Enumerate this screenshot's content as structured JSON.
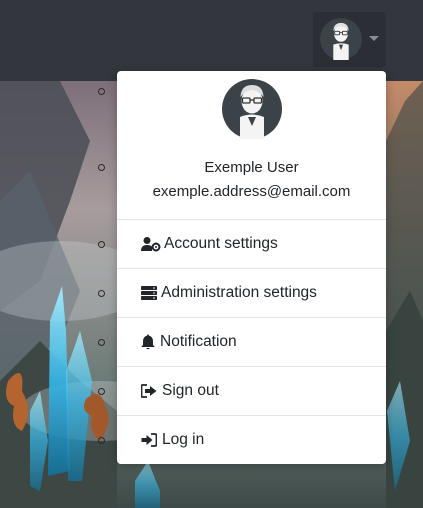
{
  "user": {
    "name": "Exemple User",
    "email": "exemple.address@email.com",
    "avatar_icon": "user-avatar-icon"
  },
  "menu": {
    "items": [
      {
        "label": "Account settings",
        "icon": "user-cog-icon"
      },
      {
        "label": "Administration settings",
        "icon": "server-icon"
      },
      {
        "label": "Notification",
        "icon": "bell-icon"
      },
      {
        "label": "Sign out",
        "icon": "sign-out-icon"
      },
      {
        "label": "Log in",
        "icon": "sign-in-icon"
      }
    ]
  },
  "colors": {
    "navbar": "#33363d",
    "avatar_bg": "#3b4248",
    "menu_bg": "#ffffff",
    "text": "#212529"
  }
}
